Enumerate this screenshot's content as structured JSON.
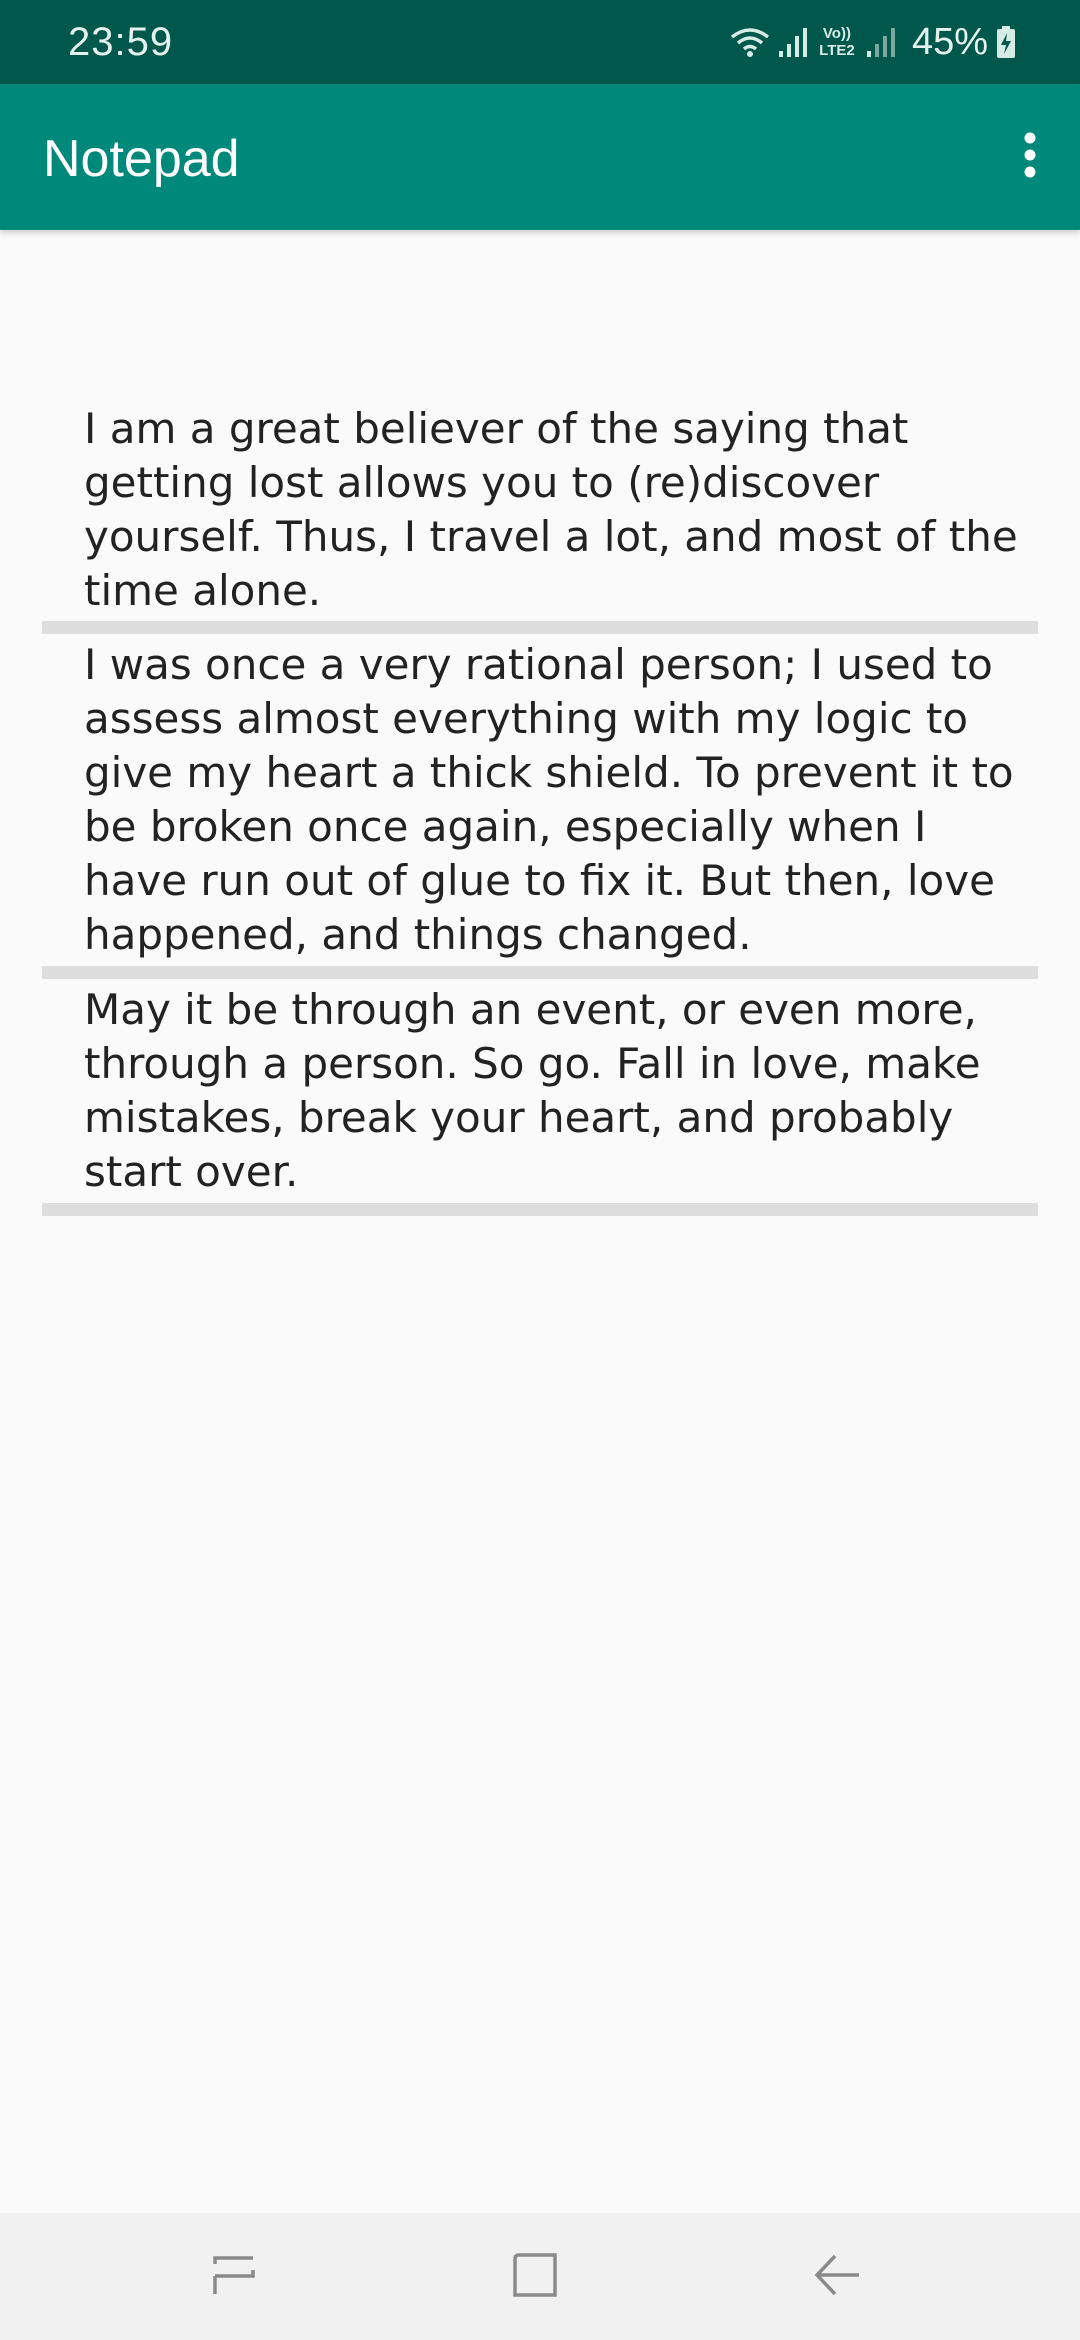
{
  "status_bar": {
    "time": "23:59",
    "network_label": "Vo)) LTE2",
    "battery": "45%",
    "icons": [
      "wifi-icon",
      "signal-icon",
      "lte-icon",
      "signal-weak-icon",
      "battery-charging-icon"
    ]
  },
  "app_bar": {
    "title": "Notepad",
    "menu_icon": "more-vert-icon"
  },
  "notes": [
    {
      "text": "I am a great believer of the saying that getting lost allows you to (re)discover yourself. Thus, I travel a lot, and most of the time alone."
    },
    {
      "text": "I was once a very rational person; I used to assess almost everything with my logic to give my heart a thick shield. To prevent it to be broken once again, especially when I have run out of glue to fix it. But then, love happened, and things changed."
    },
    {
      "text": "May it be through an event, or even more, through a person. So go. Fall in love, make mistakes, break your heart, and probably start over."
    }
  ],
  "nav_bar": {
    "icons": [
      "recents-icon",
      "home-icon",
      "back-icon"
    ]
  },
  "colors": {
    "status_bar": "#00574b",
    "app_bar": "#00897b",
    "background": "#fafafa",
    "divider": "#dddddd",
    "nav_bar": "#f1f1f1"
  }
}
